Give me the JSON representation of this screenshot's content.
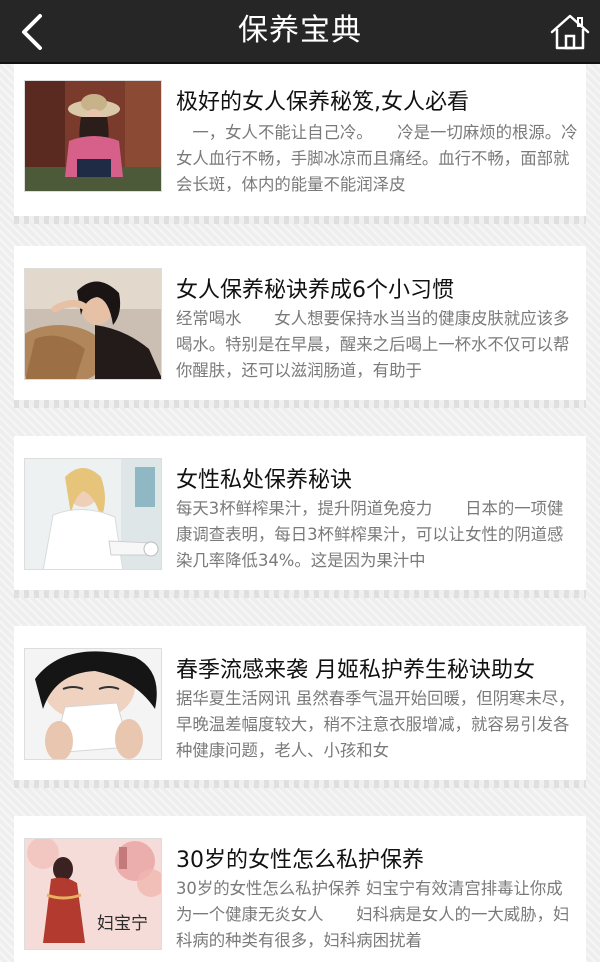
{
  "header": {
    "title": "保养宝典",
    "back_icon": "chevron-left-icon",
    "home_icon": "home-icon"
  },
  "articles": [
    {
      "title": "极好的女人保养秘笈,女人必看",
      "summary": "　一，女人不能让自己冷。　　冷是一切麻烦的根源。冷女人血行不畅，手脚冰凉而且痛经。血行不畅，面部就会长斑，体内的能量不能润泽皮"
    },
    {
      "title": "女人保养秘诀养成6个小习惯",
      "summary": "经常喝水　　女人想要保持水当当的健康皮肤就应该多喝水。特别是在早晨，醒来之后喝上一杯水不仅可以帮你醒肤，还可以滋润肠道，有助于"
    },
    {
      "title": "女性私处保养秘诀",
      "summary": "每天3杯鲜榨果汁，提升阴道免疫力　　日本的一项健康调查表明，每日3杯鲜榨果汁，可以让女性的阴道感染几率降低34%。这是因为果汁中"
    },
    {
      "title": "春季流感来袭 月姬私护养生秘诀助女",
      "summary": "据华夏生活网讯 虽然春季气温开始回暖，但阴寒未尽，早晚温差幅度较大，稍不注意衣服增减，就容易引发各种健康问题，老人、小孩和女"
    },
    {
      "title": "30岁的女性怎么私护保养",
      "summary": "30岁的女性怎么私护保养 妇宝宁有效清宫排毒让你成为一个健康无炎女人　　妇科病是女人的一大威胁，妇科病的种类有很多，妇科病困扰着",
      "thumb_text": "妇宝宁"
    }
  ],
  "colors": {
    "header_bg": "#262626",
    "card_bg": "#ffffff",
    "title_text": "#111111",
    "summary_text": "#7a7a7a"
  }
}
